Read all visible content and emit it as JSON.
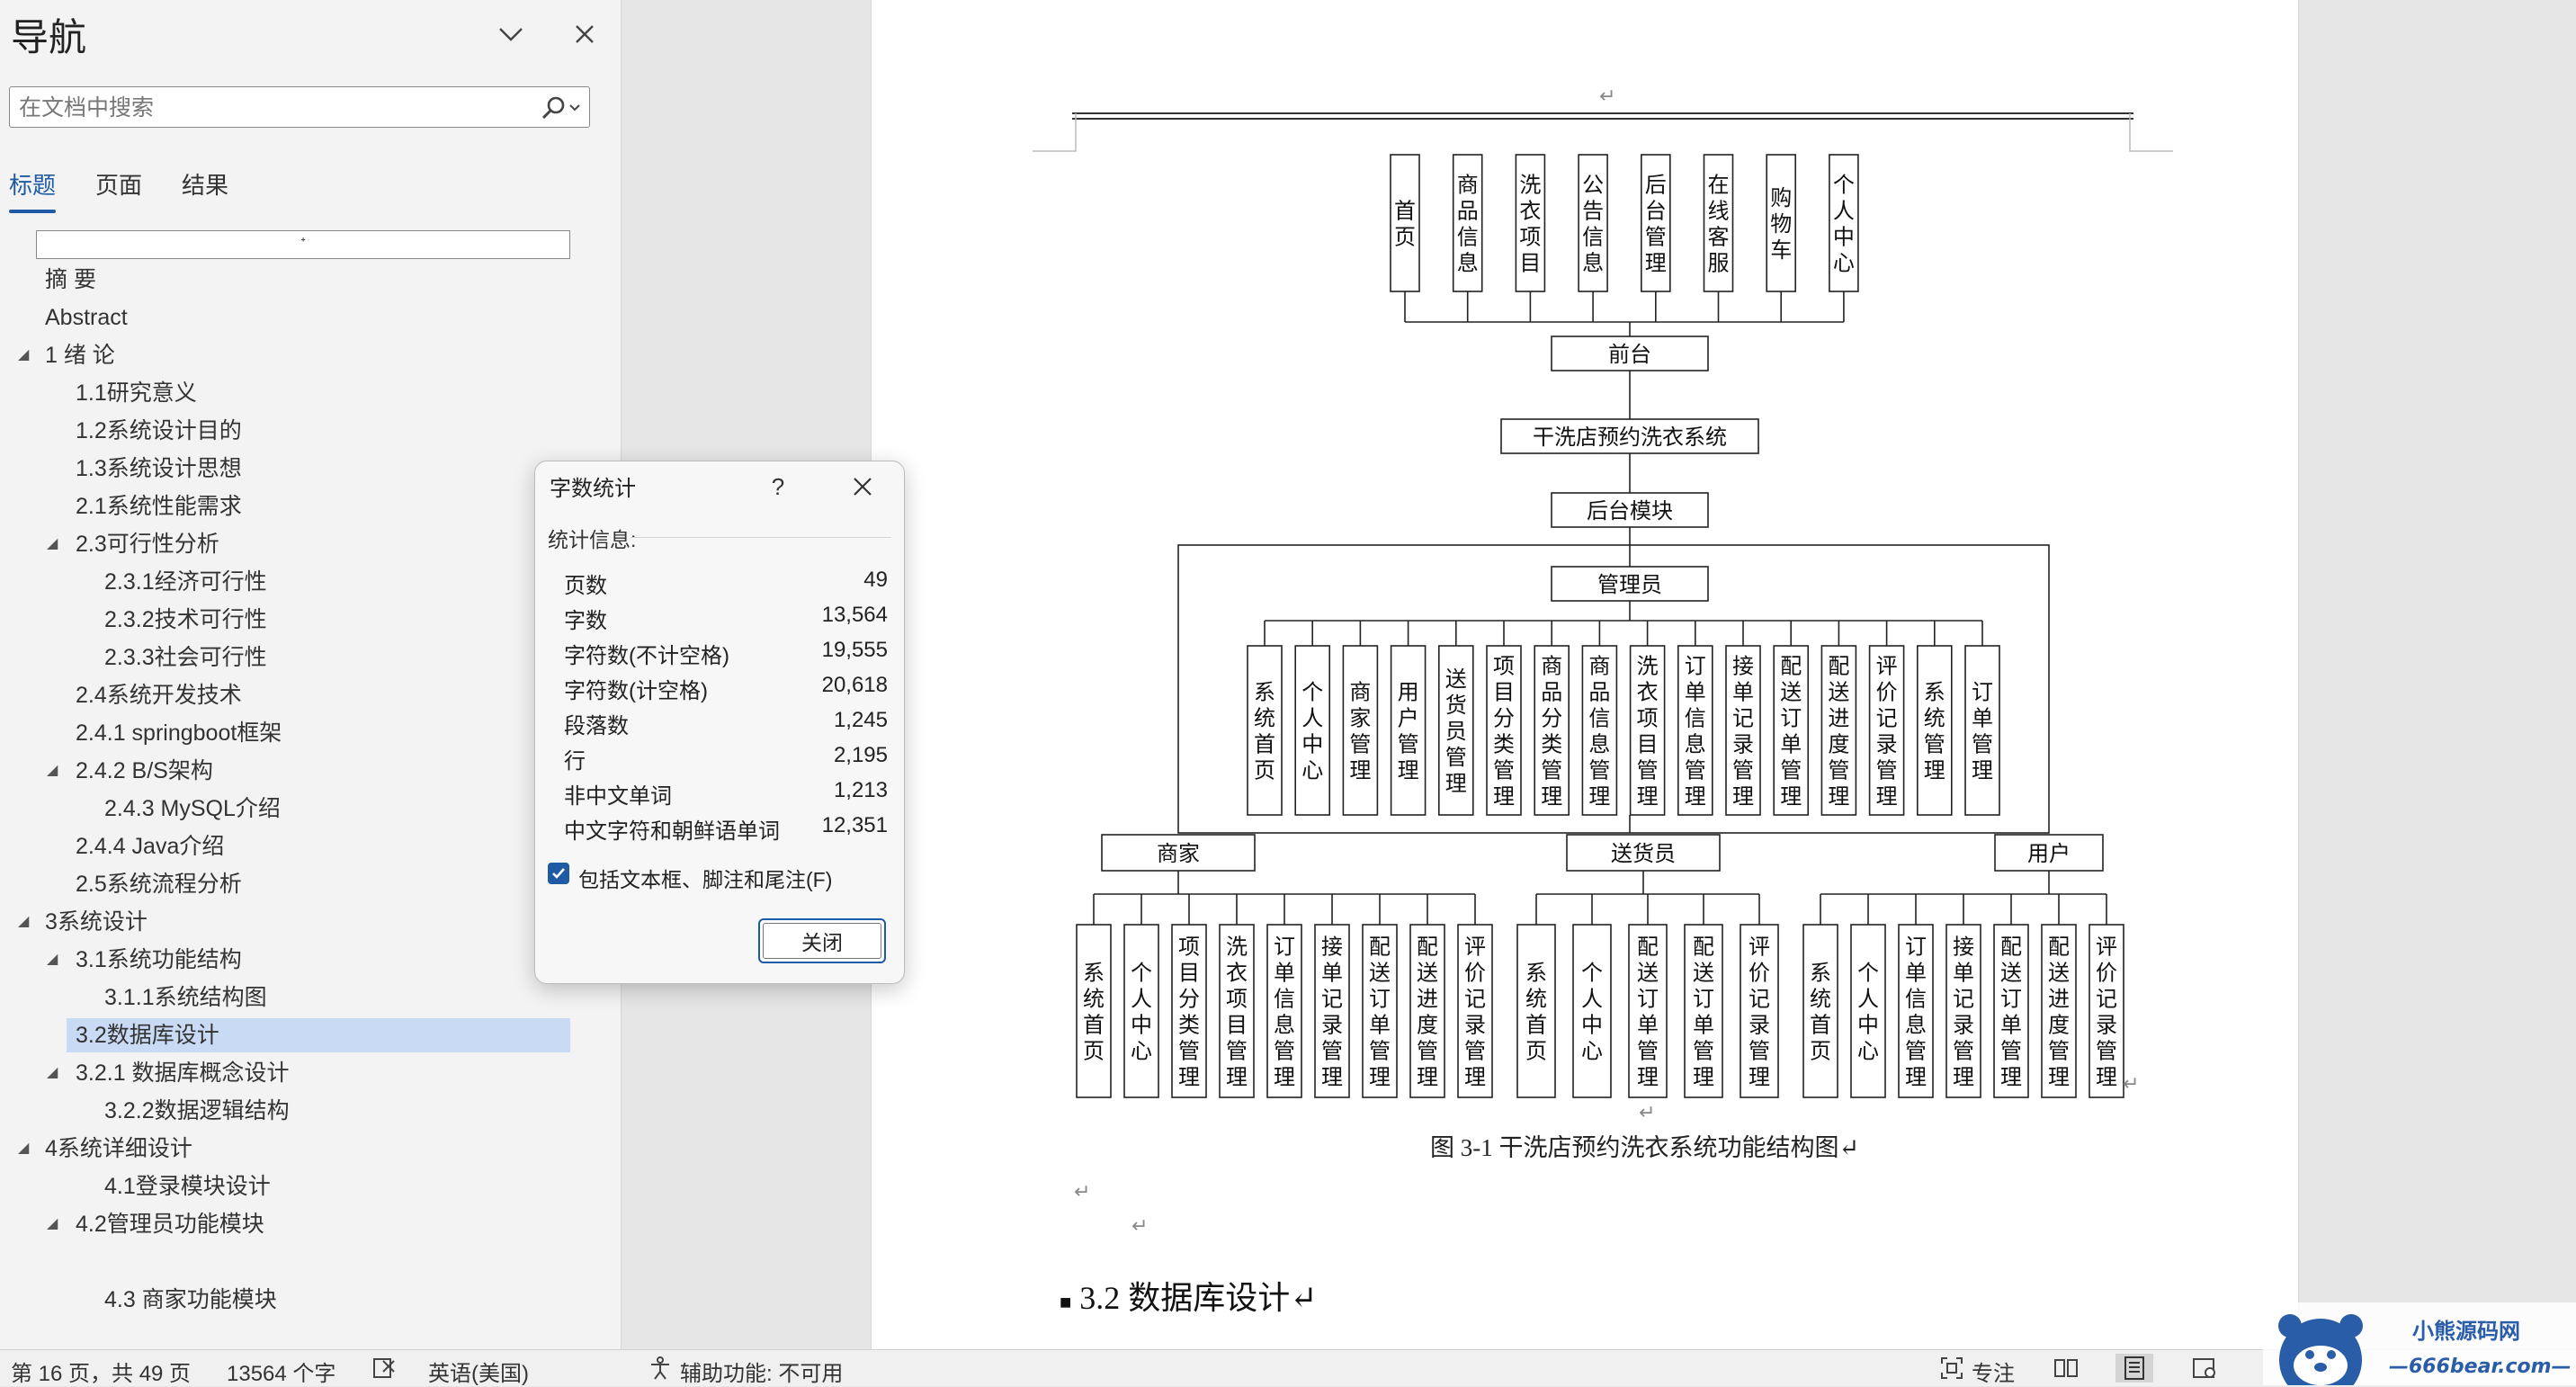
{
  "nav": {
    "title": "导航",
    "search_placeholder": "在文档中搜索",
    "tabs": [
      {
        "label": "标题"
      },
      {
        "label": "页面"
      },
      {
        "label": "结果"
      }
    ],
    "heading_edit_mark": "ᐩ",
    "items": [
      {
        "label": "摘  要"
      },
      {
        "label": "Abstract"
      },
      {
        "label": "1 绪  论"
      },
      {
        "label": "1.1研究意义"
      },
      {
        "label": "1.2系统设计目的"
      },
      {
        "label": "1.3系统设计思想"
      },
      {
        "label": "2.1系统性能需求"
      },
      {
        "label": "2.3可行性分析"
      },
      {
        "label": "2.3.1经济可行性"
      },
      {
        "label": "2.3.2技术可行性"
      },
      {
        "label": "2.3.3社会可行性"
      },
      {
        "label": "2.4系统开发技术"
      },
      {
        "label": "2.4.1 springboot框架"
      },
      {
        "label": "2.4.2 B/S架构"
      },
      {
        "label": "2.4.3 MySQL介绍"
      },
      {
        "label": "2.4.4 Java介绍"
      },
      {
        "label": "2.5系统流程分析"
      },
      {
        "label": "3系统设计"
      },
      {
        "label": "3.1系统功能结构"
      },
      {
        "label": "3.1.1系统结构图"
      },
      {
        "label": "3.2数据库设计"
      },
      {
        "label": "3.2.1 数据库概念设计"
      },
      {
        "label": "3.2.2数据逻辑结构"
      },
      {
        "label": "4系统详细设计"
      },
      {
        "label": "4.1登录模块设计"
      },
      {
        "label": "4.2管理员功能模块"
      },
      {
        "label": "4.3 商家功能模块"
      }
    ]
  },
  "dialog": {
    "title": "字数统计",
    "help": "?",
    "stats_label": "统计信息:",
    "stats": [
      {
        "label": "页数",
        "value": "49"
      },
      {
        "label": "字数",
        "value": "13,564"
      },
      {
        "label": "字符数(不计空格)",
        "value": "19,555"
      },
      {
        "label": "字符数(计空格)",
        "value": "20,618"
      },
      {
        "label": "段落数",
        "value": "1,245"
      },
      {
        "label": "行",
        "value": "2,195"
      },
      {
        "label": "非中文单词",
        "value": "1,213"
      },
      {
        "label": "中文字符和朝鲜语单词",
        "value": "12,351"
      }
    ],
    "checkbox_label": "包括文本框、脚注和尾注(F)",
    "checkbox_checked": true,
    "close_label": "关闭"
  },
  "document": {
    "paragraph_mark": "↵",
    "caption": "图 3-1  干洗店预约洗衣系统功能结构图↵",
    "section_heading": "3.2 数据库设计↵",
    "diagram": {
      "front_items": [
        "首页",
        "商品信息",
        "洗衣项目",
        "公告信息",
        "后台管理",
        "在线客服",
        "购物车",
        "个人中心"
      ],
      "front_label": "前台",
      "system_label": "干洗店预约洗衣系统",
      "backend_label": "后台模块",
      "admin_label": "管理员",
      "admin_items": [
        "系统首页",
        "个人中心",
        "商家管理",
        "用户管理",
        "送货员管理",
        "项目分类管理",
        "商品分类管理",
        "商品信息管理",
        "洗衣项目管理",
        "订单信息管理",
        "接单记录管理",
        "配送订单管理",
        "配送进度管理",
        "评价记录管理",
        "系统管理",
        "订单管理"
      ],
      "merchant_label": "商家",
      "merchant_items": [
        "系统首页",
        "个人中心",
        "项目分类管理",
        "洗衣项目管理",
        "订单信息管理",
        "接单记录管理",
        "配送订单管理",
        "配送进度管理",
        "评价记录管理"
      ],
      "courier_label": "送货员",
      "courier_items": [
        "系统首页",
        "个人中心",
        "配送订单管理",
        "配送订单管理",
        "评价记录管理"
      ],
      "user_label": "用户",
      "user_items": [
        "系统首页",
        "个人中心",
        "订单信息管理",
        "接单记录管理",
        "配送订单管理",
        "配送进度管理",
        "评价记录管理"
      ]
    }
  },
  "statusbar": {
    "page_info": "第 16 页，共 49 页",
    "word_count": "13564 个字",
    "language": "英语(美国)",
    "accessibility": "辅助功能: 不可用",
    "focus": "专注"
  },
  "watermark": {
    "brand": "小熊源码网",
    "url": "—666bear.com—"
  },
  "colors": {
    "accent": "#1f5aa5",
    "selected_heading": "#c9daf4",
    "pane_bg": "#f3f3f3"
  }
}
